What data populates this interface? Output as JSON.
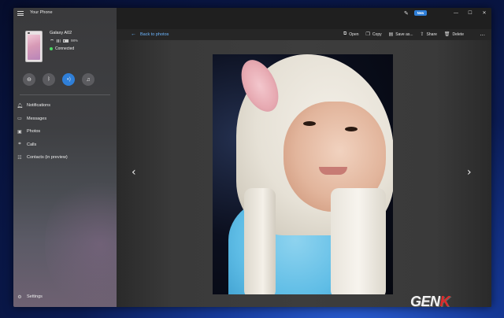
{
  "app": {
    "title": "Your Phone",
    "new_badge": "New"
  },
  "device": {
    "name": "Galaxy A02",
    "battery": "98%",
    "status": "Connected"
  },
  "quick_actions": [
    {
      "icon": "do-not-disturb-icon",
      "active": false
    },
    {
      "icon": "bluetooth-icon",
      "active": false
    },
    {
      "icon": "sound-icon",
      "active": true
    },
    {
      "icon": "music-icon",
      "active": false
    }
  ],
  "nav": [
    {
      "label": "Notifications",
      "icon": "bell-icon"
    },
    {
      "label": "Messages",
      "icon": "message-icon"
    },
    {
      "label": "Photos",
      "icon": "photo-icon"
    },
    {
      "label": "Calls",
      "icon": "phone-icon"
    },
    {
      "label": "Contacts (in preview)",
      "icon": "contacts-icon"
    }
  ],
  "settings_label": "Settings",
  "toolbar": {
    "back_label": "Back to photos",
    "actions": [
      {
        "label": "Open",
        "icon": "open-icon"
      },
      {
        "label": "Copy",
        "icon": "copy-icon"
      },
      {
        "label": "Save as...",
        "icon": "save-icon"
      },
      {
        "label": "Share",
        "icon": "share-icon"
      },
      {
        "label": "Delete",
        "icon": "trash-icon"
      }
    ],
    "more": "..."
  },
  "watermark": {
    "part1": "GEN",
    "part2": "K"
  },
  "colors": {
    "accent": "#2f7fd8",
    "link": "#6cb6ff",
    "connected": "#4cd964"
  }
}
